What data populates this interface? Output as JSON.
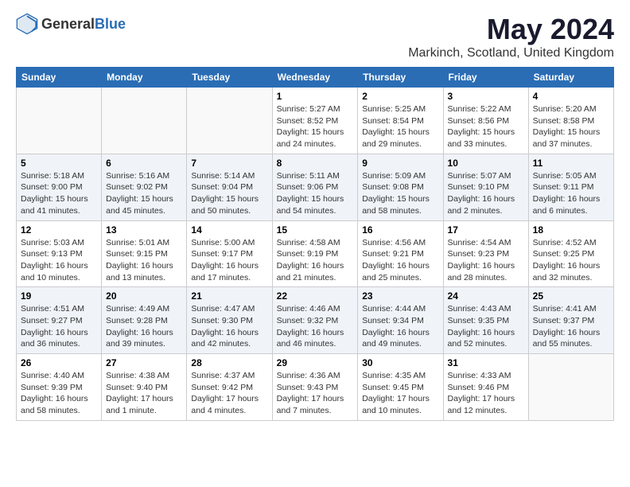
{
  "header": {
    "logo": {
      "general": "General",
      "blue": "Blue"
    },
    "title": "May 2024",
    "location": "Markinch, Scotland, United Kingdom"
  },
  "weekdays": [
    "Sunday",
    "Monday",
    "Tuesday",
    "Wednesday",
    "Thursday",
    "Friday",
    "Saturday"
  ],
  "weeks": [
    [
      {
        "day": "",
        "info": ""
      },
      {
        "day": "",
        "info": ""
      },
      {
        "day": "",
        "info": ""
      },
      {
        "day": "1",
        "info": "Sunrise: 5:27 AM\nSunset: 8:52 PM\nDaylight: 15 hours\nand 24 minutes."
      },
      {
        "day": "2",
        "info": "Sunrise: 5:25 AM\nSunset: 8:54 PM\nDaylight: 15 hours\nand 29 minutes."
      },
      {
        "day": "3",
        "info": "Sunrise: 5:22 AM\nSunset: 8:56 PM\nDaylight: 15 hours\nand 33 minutes."
      },
      {
        "day": "4",
        "info": "Sunrise: 5:20 AM\nSunset: 8:58 PM\nDaylight: 15 hours\nand 37 minutes."
      }
    ],
    [
      {
        "day": "5",
        "info": "Sunrise: 5:18 AM\nSunset: 9:00 PM\nDaylight: 15 hours\nand 41 minutes."
      },
      {
        "day": "6",
        "info": "Sunrise: 5:16 AM\nSunset: 9:02 PM\nDaylight: 15 hours\nand 45 minutes."
      },
      {
        "day": "7",
        "info": "Sunrise: 5:14 AM\nSunset: 9:04 PM\nDaylight: 15 hours\nand 50 minutes."
      },
      {
        "day": "8",
        "info": "Sunrise: 5:11 AM\nSunset: 9:06 PM\nDaylight: 15 hours\nand 54 minutes."
      },
      {
        "day": "9",
        "info": "Sunrise: 5:09 AM\nSunset: 9:08 PM\nDaylight: 15 hours\nand 58 minutes."
      },
      {
        "day": "10",
        "info": "Sunrise: 5:07 AM\nSunset: 9:10 PM\nDaylight: 16 hours\nand 2 minutes."
      },
      {
        "day": "11",
        "info": "Sunrise: 5:05 AM\nSunset: 9:11 PM\nDaylight: 16 hours\nand 6 minutes."
      }
    ],
    [
      {
        "day": "12",
        "info": "Sunrise: 5:03 AM\nSunset: 9:13 PM\nDaylight: 16 hours\nand 10 minutes."
      },
      {
        "day": "13",
        "info": "Sunrise: 5:01 AM\nSunset: 9:15 PM\nDaylight: 16 hours\nand 13 minutes."
      },
      {
        "day": "14",
        "info": "Sunrise: 5:00 AM\nSunset: 9:17 PM\nDaylight: 16 hours\nand 17 minutes."
      },
      {
        "day": "15",
        "info": "Sunrise: 4:58 AM\nSunset: 9:19 PM\nDaylight: 16 hours\nand 21 minutes."
      },
      {
        "day": "16",
        "info": "Sunrise: 4:56 AM\nSunset: 9:21 PM\nDaylight: 16 hours\nand 25 minutes."
      },
      {
        "day": "17",
        "info": "Sunrise: 4:54 AM\nSunset: 9:23 PM\nDaylight: 16 hours\nand 28 minutes."
      },
      {
        "day": "18",
        "info": "Sunrise: 4:52 AM\nSunset: 9:25 PM\nDaylight: 16 hours\nand 32 minutes."
      }
    ],
    [
      {
        "day": "19",
        "info": "Sunrise: 4:51 AM\nSunset: 9:27 PM\nDaylight: 16 hours\nand 36 minutes."
      },
      {
        "day": "20",
        "info": "Sunrise: 4:49 AM\nSunset: 9:28 PM\nDaylight: 16 hours\nand 39 minutes."
      },
      {
        "day": "21",
        "info": "Sunrise: 4:47 AM\nSunset: 9:30 PM\nDaylight: 16 hours\nand 42 minutes."
      },
      {
        "day": "22",
        "info": "Sunrise: 4:46 AM\nSunset: 9:32 PM\nDaylight: 16 hours\nand 46 minutes."
      },
      {
        "day": "23",
        "info": "Sunrise: 4:44 AM\nSunset: 9:34 PM\nDaylight: 16 hours\nand 49 minutes."
      },
      {
        "day": "24",
        "info": "Sunrise: 4:43 AM\nSunset: 9:35 PM\nDaylight: 16 hours\nand 52 minutes."
      },
      {
        "day": "25",
        "info": "Sunrise: 4:41 AM\nSunset: 9:37 PM\nDaylight: 16 hours\nand 55 minutes."
      }
    ],
    [
      {
        "day": "26",
        "info": "Sunrise: 4:40 AM\nSunset: 9:39 PM\nDaylight: 16 hours\nand 58 minutes."
      },
      {
        "day": "27",
        "info": "Sunrise: 4:38 AM\nSunset: 9:40 PM\nDaylight: 17 hours\nand 1 minute."
      },
      {
        "day": "28",
        "info": "Sunrise: 4:37 AM\nSunset: 9:42 PM\nDaylight: 17 hours\nand 4 minutes."
      },
      {
        "day": "29",
        "info": "Sunrise: 4:36 AM\nSunset: 9:43 PM\nDaylight: 17 hours\nand 7 minutes."
      },
      {
        "day": "30",
        "info": "Sunrise: 4:35 AM\nSunset: 9:45 PM\nDaylight: 17 hours\nand 10 minutes."
      },
      {
        "day": "31",
        "info": "Sunrise: 4:33 AM\nSunset: 9:46 PM\nDaylight: 17 hours\nand 12 minutes."
      },
      {
        "day": "",
        "info": ""
      }
    ]
  ]
}
